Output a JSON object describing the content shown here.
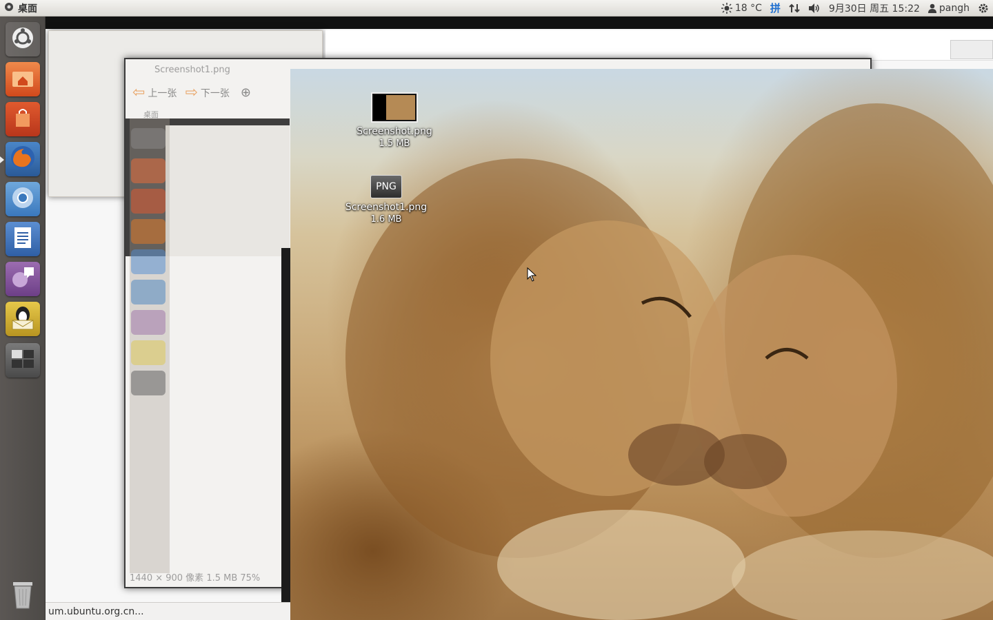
{
  "top_panel": {
    "app_name": "桌面",
    "weather": "18 °C",
    "ime": "拼",
    "datetime": "9月30日 周五 15:22",
    "user": "pangh"
  },
  "launcher": {
    "items": [
      {
        "name": "dash-home",
        "icon": "ubuntu-logo-icon"
      },
      {
        "name": "home-folder",
        "icon": "home-folder-icon"
      },
      {
        "name": "software-center",
        "icon": "shopping-bag-icon"
      },
      {
        "name": "firefox",
        "icon": "firefox-icon",
        "running": true
      },
      {
        "name": "chromium",
        "icon": "chromium-icon"
      },
      {
        "name": "libreoffice-writer",
        "icon": "writer-icon"
      },
      {
        "name": "empathy",
        "icon": "chat-icon"
      },
      {
        "name": "qq-mail",
        "icon": "penguin-mail-icon"
      },
      {
        "name": "workspace-switcher",
        "icon": "workspaces-icon"
      },
      {
        "name": "trash",
        "icon": "trash-icon"
      }
    ]
  },
  "ghost_viewer": {
    "title": "Screenshot1.png",
    "prev_label": "上一张",
    "next_label": "下一张",
    "status": "1440 × 900 像素   1.5 MB   75%",
    "app_name": "桌面"
  },
  "browser_status": "um.ubuntu.org.cn...",
  "desktop_icons": [
    {
      "name": "Screenshot.png",
      "size": "1.5 MB",
      "kind": "thumbnail"
    },
    {
      "name": "Screenshot1.png",
      "size": "1.6 MB",
      "kind": "png",
      "badge": "PNG"
    }
  ]
}
